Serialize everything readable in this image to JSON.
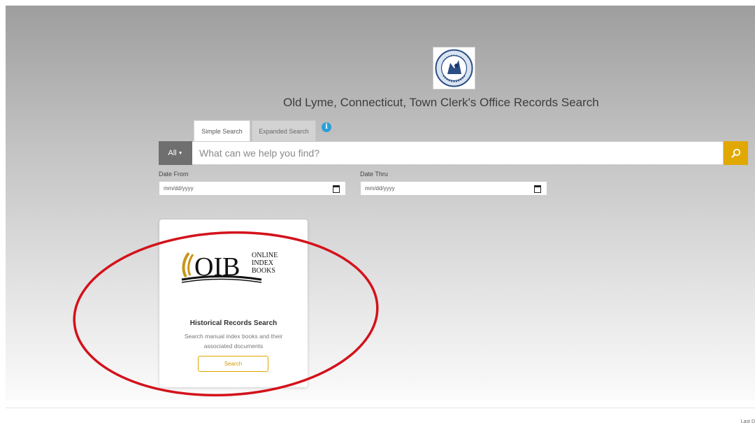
{
  "header": {
    "title": "Old Lyme, Connecticut, Town Clerk's Office Records Search",
    "seal_icon": "town-seal-icon"
  },
  "tabs": [
    {
      "label": "Simple Search",
      "active": true
    },
    {
      "label": "Expanded Search",
      "active": false
    }
  ],
  "search": {
    "scope_label": "All",
    "placeholder": "What can we help you find?",
    "value": "",
    "button_icon": "search-icon"
  },
  "dates": {
    "from_label": "Date From",
    "from_placeholder": "mm/dd/yyyy",
    "thru_label": "Date Thru",
    "thru_placeholder": "mm/dd/yyyy"
  },
  "card": {
    "logo_text": "OIB",
    "logo_line1": "ONLINE",
    "logo_line2": "INDEX",
    "logo_line3": "BOOKS",
    "title": "Historical Records Search",
    "description": "Search manual index books and their associated documents",
    "button_label": "Search"
  },
  "footer": {
    "text": "Last D"
  },
  "colors": {
    "accent": "#e0a800",
    "annotation": "#d3121b",
    "info": "#2a9fd8"
  }
}
